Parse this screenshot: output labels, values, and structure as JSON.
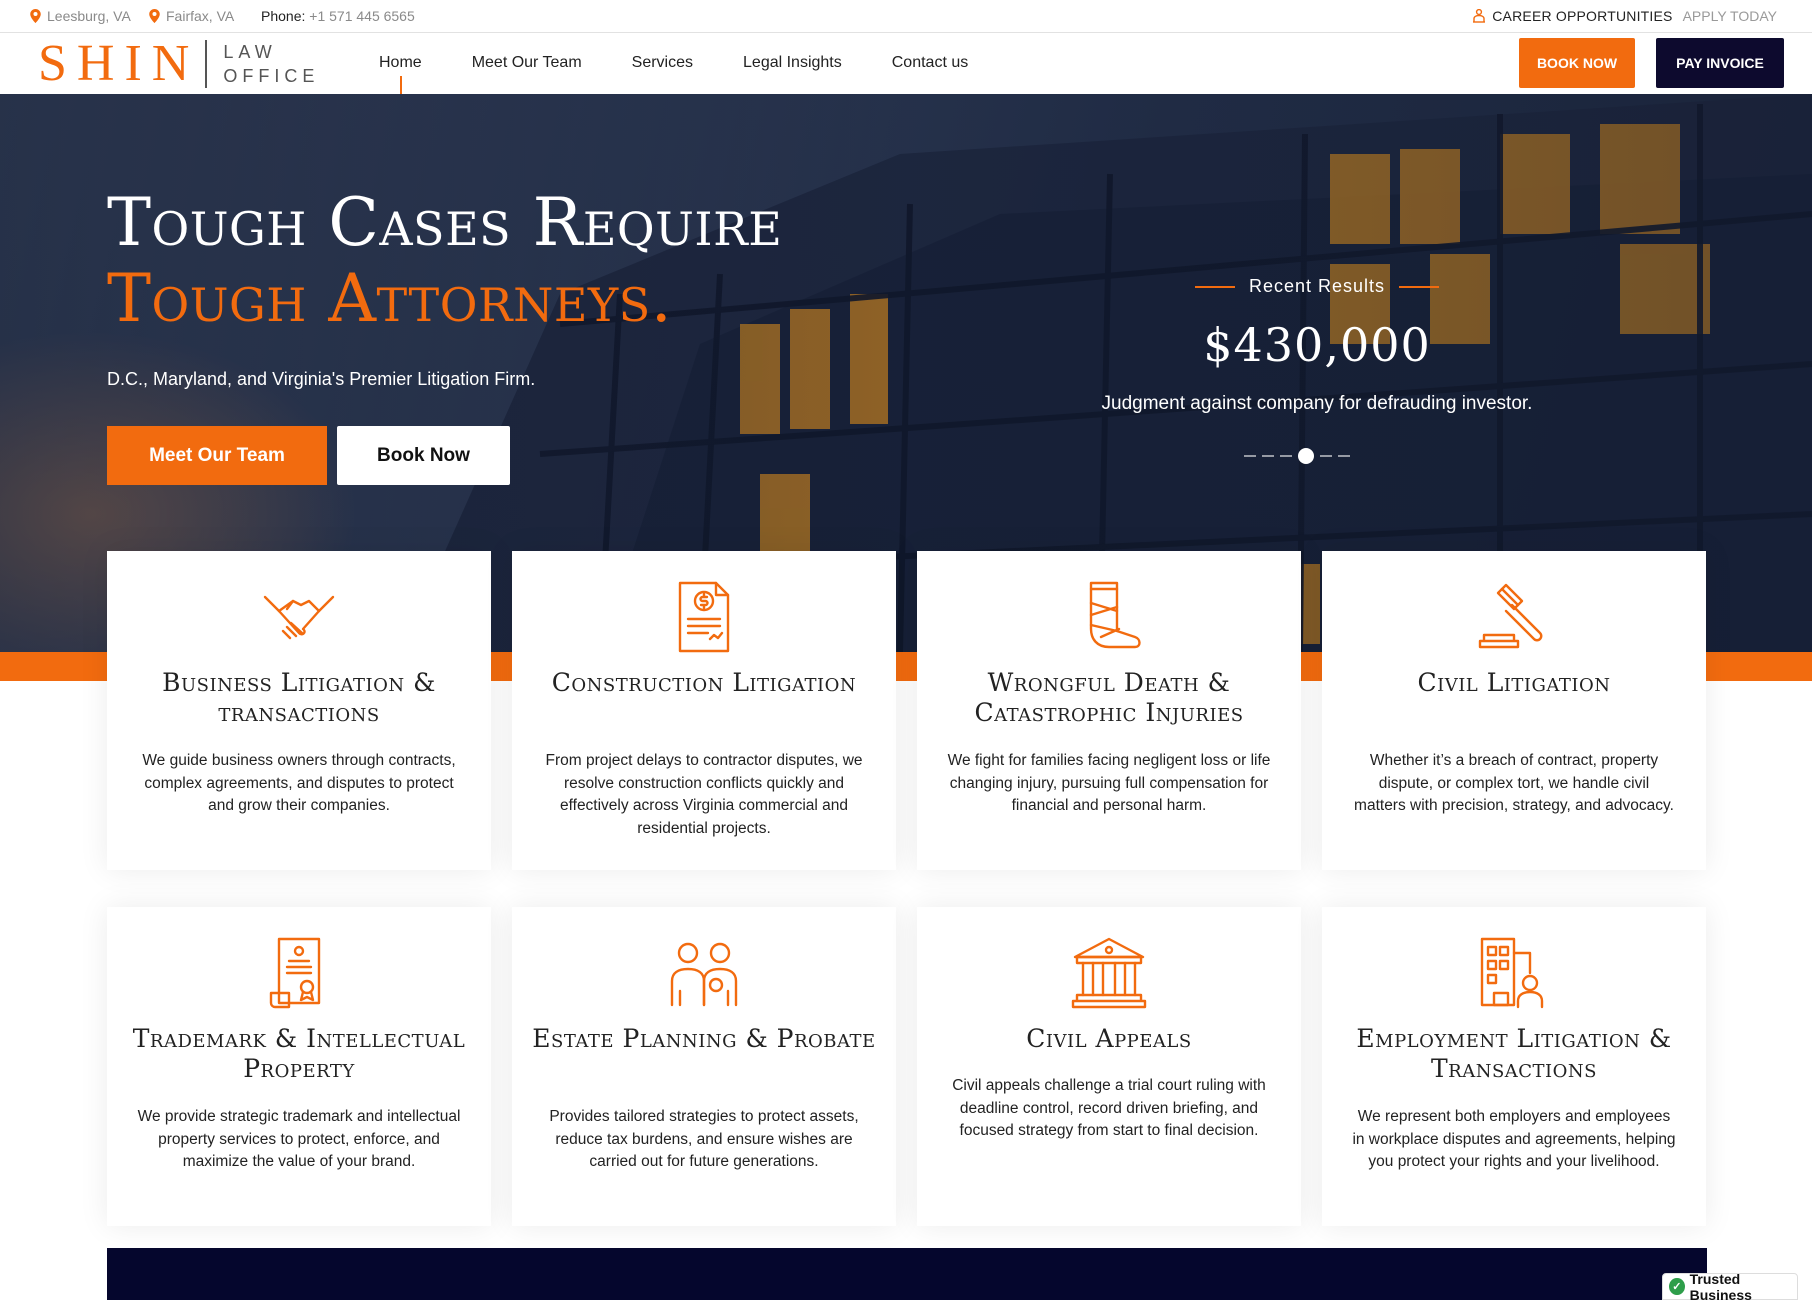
{
  "topbar": {
    "locations": [
      "Leesburg, VA",
      "Fairfax, VA"
    ],
    "phone_label": "Phone:",
    "phone_number": "+1 571 445 6565",
    "career_label": "CAREER OPPORTUNITIES",
    "career_link": "APPLY TODAY"
  },
  "header": {
    "logo_main": "SHIN",
    "logo_line1": "LAW",
    "logo_line2": "OFFICE",
    "nav": [
      "Home",
      "Meet Our Team",
      "Services",
      "Legal Insights",
      "Contact us"
    ],
    "book_label": "BOOK NOW",
    "pay_label": "PAY INVOICE"
  },
  "hero": {
    "title_line1": "Tough Cases Require",
    "title_line2": "Tough Attorneys.",
    "subtitle": "D.C., Maryland, and Virginia's Premier Litigation Firm.",
    "button_team": "Meet Our Team",
    "button_book": "Book Now",
    "results_label": "Recent Results",
    "result_amount": "$430,000",
    "result_desc": "Judgment against company for defrauding investor."
  },
  "services": [
    {
      "title": "Business Litigation & transactions",
      "icon": "handshake-icon",
      "text": "We guide business owners through contracts, complex agreements, and disputes to protect and grow their companies."
    },
    {
      "title": "Construction Litigation",
      "icon": "invoice-document-icon",
      "text": "From project delays to contractor disputes, we resolve construction conflicts quickly and effectively across Virginia commercial and residential projects."
    },
    {
      "title": "Wrongful Death & Catastrophic Injuries",
      "icon": "leg-cast-icon",
      "text": "We fight for families facing negligent loss or life changing injury, pursuing full compensation for financial and personal harm."
    },
    {
      "title": "Civil Litigation",
      "icon": "gavel-icon",
      "text": "Whether it’s a breach of contract, property dispute, or complex tort, we handle civil matters with precision, strategy, and advocacy."
    },
    {
      "title": "Trademark & Intellectual Property",
      "icon": "certificate-icon",
      "text": "We provide strategic trademark and intellectual property services to protect, enforce, and maximize the value of your brand."
    },
    {
      "title": "Estate Planning & Probate",
      "icon": "family-icon",
      "text": "Provides tailored strategies to protect assets, reduce tax burdens, and ensure wishes are carried out for future generations."
    },
    {
      "title": "Civil Appeals",
      "icon": "courthouse-icon",
      "text": "Civil appeals challenge a trial court ruling with deadline control, record driven briefing, and focused strategy from start to final decision."
    },
    {
      "title": "Employment Litigation & Transactions",
      "icon": "office-worker-icon",
      "text": "We represent both employers and employees in workplace disputes and agreements, helping you protect your rights and your livelihood."
    }
  ],
  "badge": {
    "label": "Trusted Business"
  },
  "colors": {
    "accent": "#f26b0f",
    "navy": "#0d0a2e"
  }
}
